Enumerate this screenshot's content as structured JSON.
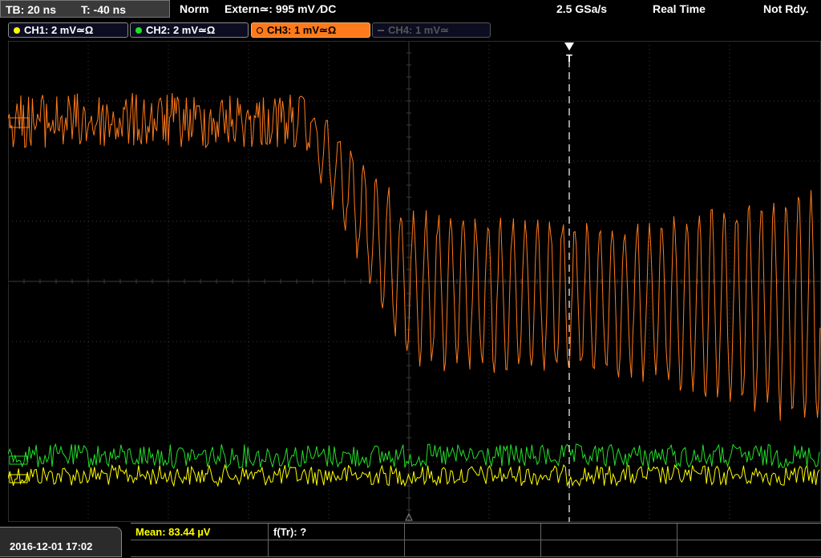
{
  "status_bar": {
    "timebase": "TB: 20 ns",
    "trigger_time": "T: -40 ns",
    "trigger_mode": "Norm",
    "trigger_source": "Extern≃: 995 mV ⁄DC",
    "sample_rate": "2.5 GSa/s",
    "acq_mode": "Real Time",
    "status": "Not Rdy."
  },
  "channels": [
    {
      "label": "CH1: 2 mV≃Ω",
      "color": "#ffff00",
      "active": true
    },
    {
      "label": "CH2: 2 mV≃Ω",
      "color": "#00e000",
      "active": true
    },
    {
      "label": "CH3: 1 mV≃Ω",
      "color": "#ff7a1a",
      "active": true
    },
    {
      "label": "CH4: 1 mV≃",
      "color": "#555555",
      "active": false
    }
  ],
  "trigger_marker": {
    "label": "T"
  },
  "footer": {
    "datetime": "2016-12-01 17:02",
    "measurement_1": "Mean: 83.44 µV",
    "measurement_2": "f(Tr): ?"
  },
  "colors": {
    "ch1": "#ffff00",
    "ch2": "#22e02a",
    "ch3": "#ff7a1a",
    "grid": "#3c3c3c"
  }
}
